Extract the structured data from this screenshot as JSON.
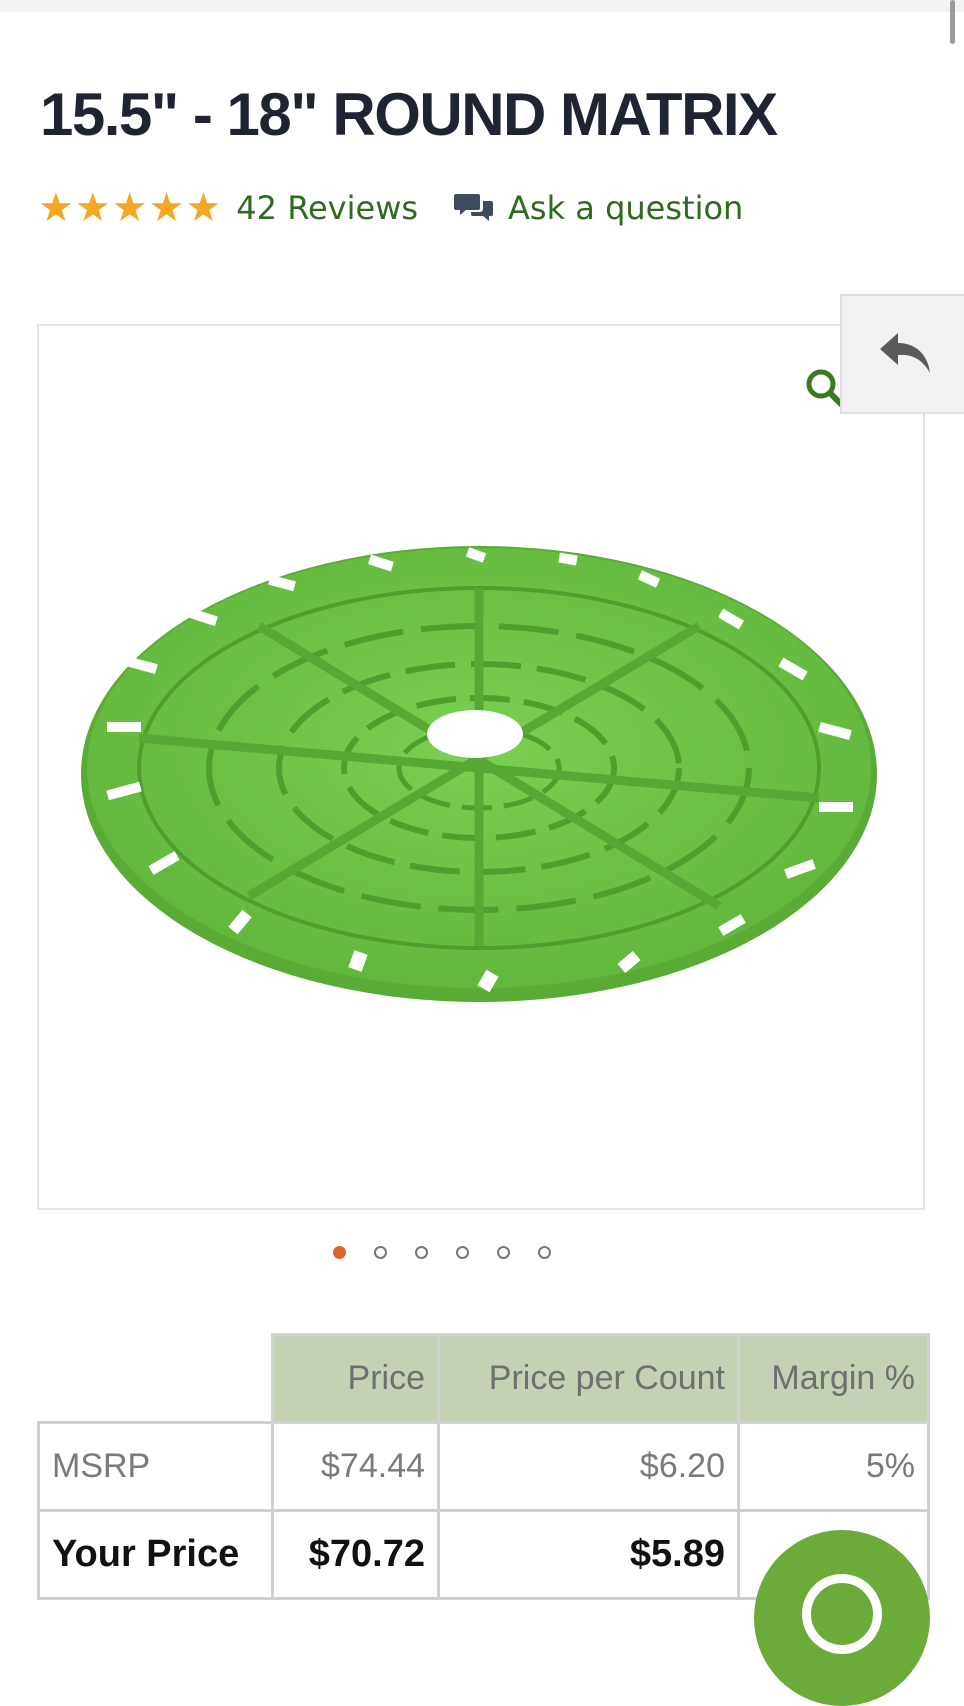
{
  "product": {
    "title": "15.5\" - 18\" ROUND MATRIX",
    "rating_stars": 5,
    "reviews_label": "42 Reviews",
    "ask_label": "Ask a question"
  },
  "gallery": {
    "image_count": 6,
    "active_index": 0,
    "product_color": "#6cc24a"
  },
  "pricing": {
    "headers": [
      "",
      "Price",
      "Price per Count",
      "Margin %"
    ],
    "rows": [
      {
        "label": "MSRP",
        "price": "$74.44",
        "per_count": "$6.20",
        "margin": "5%"
      },
      {
        "label": "Your Price",
        "price": "$70.72",
        "per_count": "$5.89",
        "margin": ""
      }
    ]
  },
  "colors": {
    "link_green": "#2f6b1f",
    "star": "#f5a623",
    "active_dot": "#e0642a",
    "header_bg": "#c4d1b4",
    "fab": "#6bab3a"
  }
}
